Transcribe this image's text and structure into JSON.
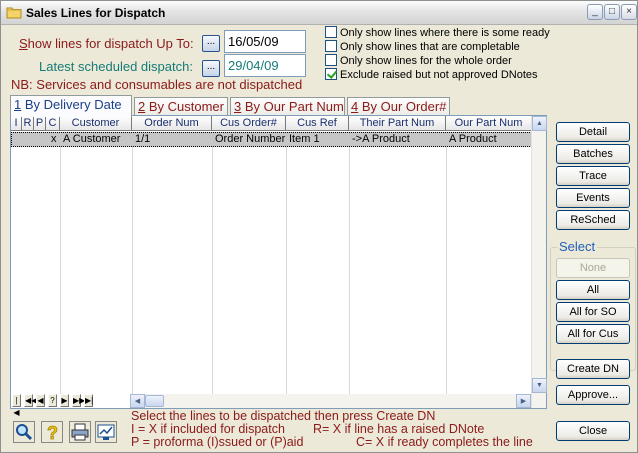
{
  "window": {
    "title": "Sales Lines for Dispatch",
    "controls": {
      "minimize": "_",
      "maximize": "□",
      "close": "×"
    }
  },
  "filters": {
    "show_upto_label": "Show lines for dispatch Up To:",
    "show_upto_accel": "S",
    "show_upto_value": "16/05/09",
    "latest_label": "Latest scheduled dispatch:",
    "latest_value": "29/04/09",
    "picker_label": "...",
    "nb_text": "NB: Services and consumables are not dispatched"
  },
  "checkboxes": [
    {
      "label": "Only show lines where there is some ready",
      "checked": false
    },
    {
      "label": "Only show lines that are completable",
      "checked": false
    },
    {
      "label": "Only show lines for the whole order",
      "checked": false
    },
    {
      "label": "Exclude raised but not approved DNotes",
      "checked": true
    }
  ],
  "tabs": [
    {
      "num": "1",
      "label": " By Delivery Date",
      "active": true
    },
    {
      "num": "2",
      "label": " By Customer",
      "active": false
    },
    {
      "num": "3",
      "label": " By Our Part Num",
      "active": false
    },
    {
      "num": "4",
      "label": " By Our Order#",
      "active": false
    }
  ],
  "grid": {
    "columns": [
      "I",
      "R",
      "P",
      "C",
      "Customer",
      "Order Num",
      "Cus Order#",
      "Cus Ref",
      "Their Part Num",
      "Our Part Num"
    ],
    "rows": [
      [
        "",
        "",
        "",
        "x",
        "A Customer",
        "1/1",
        "Order Number",
        "Item 1",
        "->A Product",
        "A Product"
      ]
    ],
    "nav_buttons": [
      "|◀",
      "◀◀",
      "◀",
      "?",
      "▶",
      "▶▶",
      "▶|"
    ]
  },
  "buttons": {
    "detail": "Detail",
    "batches": "Batches",
    "trace": "Trace",
    "events": "Events",
    "resched": "ReSched",
    "create_dn": "Create DN",
    "approve": "Approve...",
    "close": "Close"
  },
  "select_group": {
    "title": "Select",
    "none": "None",
    "all": "All",
    "all_for_so": "All for SO",
    "all_for_cus": "All for Cus"
  },
  "help": {
    "line1": "Select the lines to be dispatched then press Create DN",
    "line2a": "I = X if included for dispatch",
    "line2b": "R= X if line has a raised DNote",
    "line3a": "P = proforma (I)ssued or (P)aid",
    "line3b": "C= X if ready completes the line"
  },
  "bottom_icons": [
    "search-icon",
    "help-icon",
    "print-icon",
    "report-icon"
  ]
}
